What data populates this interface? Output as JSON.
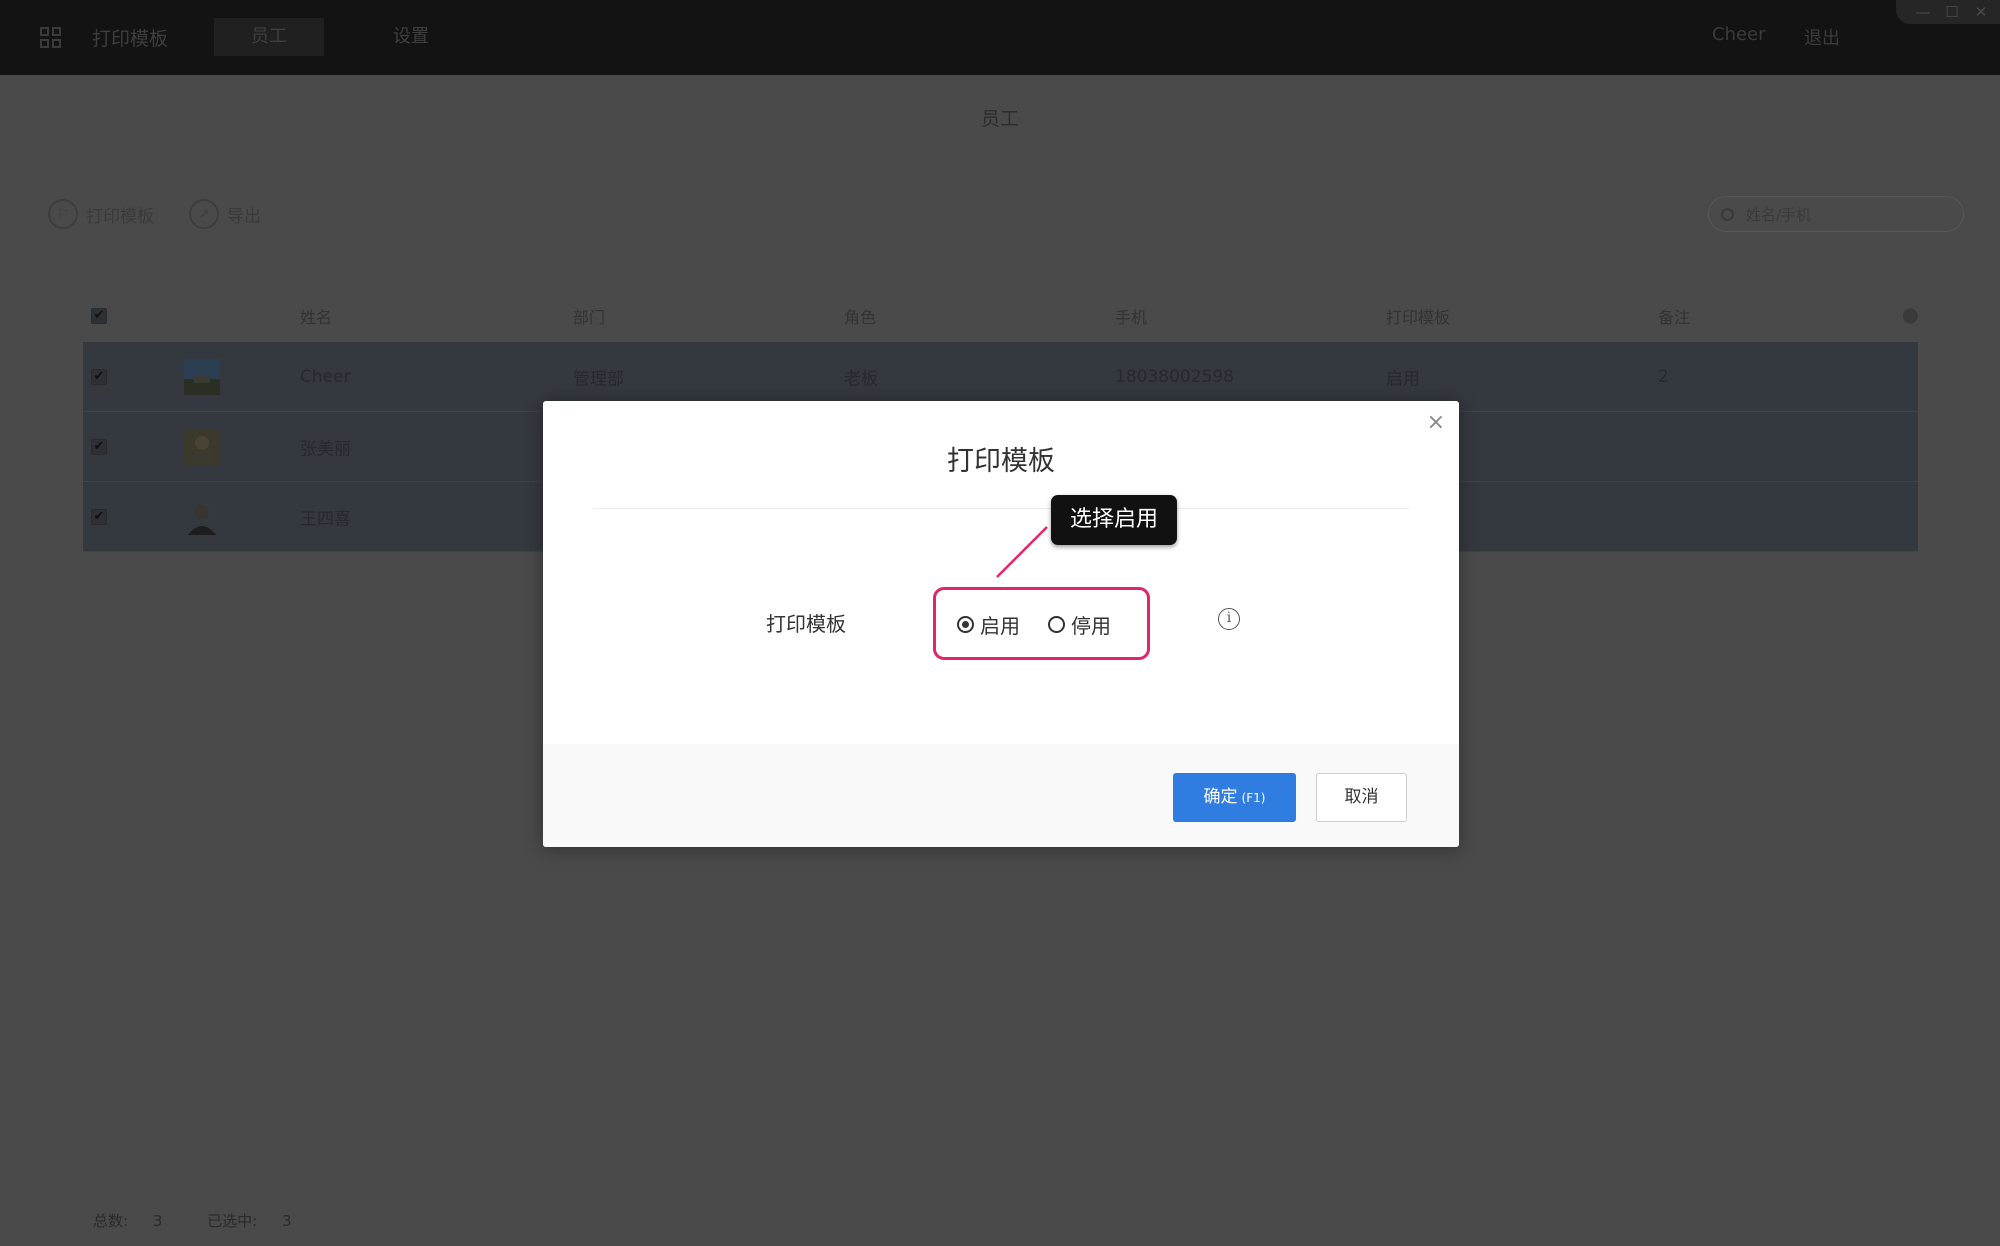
{
  "app": {
    "title": "打印模板",
    "user": "Cheer",
    "logout": "退出"
  },
  "nav": {
    "tabs": [
      {
        "label": "员工"
      },
      {
        "label": "设置"
      }
    ]
  },
  "window": {
    "minimize": "—",
    "maximize": "☐",
    "close": "✕"
  },
  "page": {
    "title": "员工"
  },
  "toolbar": {
    "print_template_label": "打印模板",
    "export_label": "导出"
  },
  "search": {
    "placeholder": "姓名/手机"
  },
  "table": {
    "columns": [
      "姓名",
      "部门",
      "角色",
      "手机",
      "打印模板",
      "备注"
    ],
    "rows": [
      {
        "name": "Cheer",
        "dept": "管理部",
        "role": "老板",
        "phone": "18038002598",
        "template": "启用",
        "note": "2"
      },
      {
        "name": "张美丽",
        "dept": "",
        "role": "",
        "phone": "",
        "template": "",
        "note": ""
      },
      {
        "name": "王四喜",
        "dept": "",
        "role": "",
        "phone": "",
        "template": "",
        "note": ""
      }
    ]
  },
  "footer": {
    "total_label": "总数:",
    "total": "3",
    "selected_label": "已选中:",
    "selected": "3"
  },
  "modal": {
    "title": "打印模板",
    "close_icon": "×",
    "field_label": "打印模板",
    "options": [
      {
        "label": "启用",
        "selected": true
      },
      {
        "label": "停用",
        "selected": false
      }
    ],
    "info_icon": "i",
    "callout": "选择启用",
    "ok_label": "确定",
    "ok_shortcut": "(F1)",
    "cancel_label": "取消"
  },
  "colors": {
    "primary": "#2f7de1",
    "highlight": "#e0256b",
    "topbar": "#131313",
    "overlay": "#4a4a4a"
  }
}
